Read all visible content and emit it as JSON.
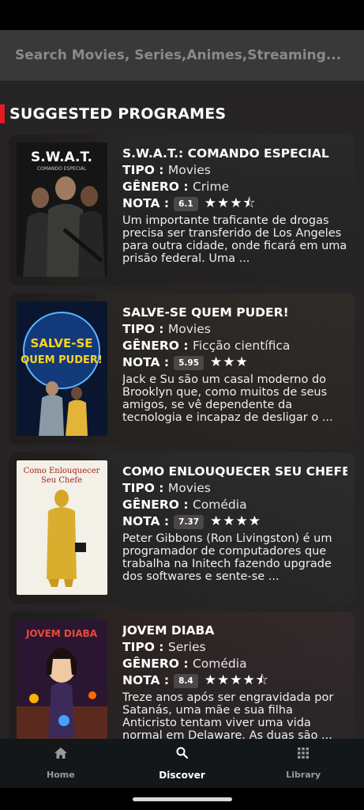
{
  "search": {
    "placeholder": "Search Movies, Series,Animes,Streaming..."
  },
  "section": {
    "title": "SUGGESTED PROGRAMES"
  },
  "labels": {
    "tipo": "TIPO",
    "genero": "GÊNERO",
    "nota": "NOTA"
  },
  "cards": [
    {
      "title": "S.W.A.T.: COMANDO ESPECIAL",
      "tipo": "Movies",
      "genero": "Crime",
      "nota": "6.1",
      "stars": "★★★⯪",
      "description": "Um importante traficante de drogas precisa ser transferido de Los Angeles para outra cidade, onde ficará em uma prisão federal. Uma ...",
      "poster_text": "S.W.A.T.",
      "poster_subtext": "COMANDO ESPECIAL",
      "colors": {
        "poster": "#1a1a1a",
        "backdrop": "#3c4650"
      }
    },
    {
      "title": "SALVE-SE QUEM PUDER!",
      "tipo": "Movies",
      "genero": "Ficção científica",
      "nota": "5.95",
      "stars": "★★★",
      "description": "Jack e Su são um casal moderno do Brooklyn que, como muitos de seus amigos, se vê dependente da tecnologia e incapaz de desligar o ...",
      "poster_text": "SALVE-SE QUEM PUDER!",
      "colors": {
        "poster": "#0b1a3a",
        "backdrop": "#5a5040"
      }
    },
    {
      "title": "COMO ENLOUQUECER SEU CHEFE",
      "tipo": "Movies",
      "genero": "Comédia",
      "nota": "7.37",
      "stars": "★★★★",
      "description": "Peter Gibbons (Ron Livingston) é um programador de computadores que trabalha na Initech fazendo upgrade dos softwares e sente-se ...",
      "poster_text": "Como Enlouquecer Seu Chefe",
      "colors": {
        "poster": "#f4f1ea",
        "backdrop": "#4a5a66"
      }
    },
    {
      "title": "JOVEM DIABA",
      "tipo": "Series",
      "genero": "Comédia",
      "nota": "8.4",
      "stars": "★★★★⯪",
      "description": "Treze anos após ser engravidada por Satanás, uma mãe e sua filha Anticristo tentam viver uma vida normal em Delaware. As duas são ...",
      "poster_text": "JOVEM DIABA",
      "colors": {
        "poster": "#2a1430",
        "backdrop": "#6a3a2a"
      }
    }
  ],
  "nav": [
    {
      "label": "Home",
      "icon": "home-icon"
    },
    {
      "label": "Discover",
      "icon": "search-icon"
    },
    {
      "label": "Library",
      "icon": "grid-icon"
    }
  ]
}
